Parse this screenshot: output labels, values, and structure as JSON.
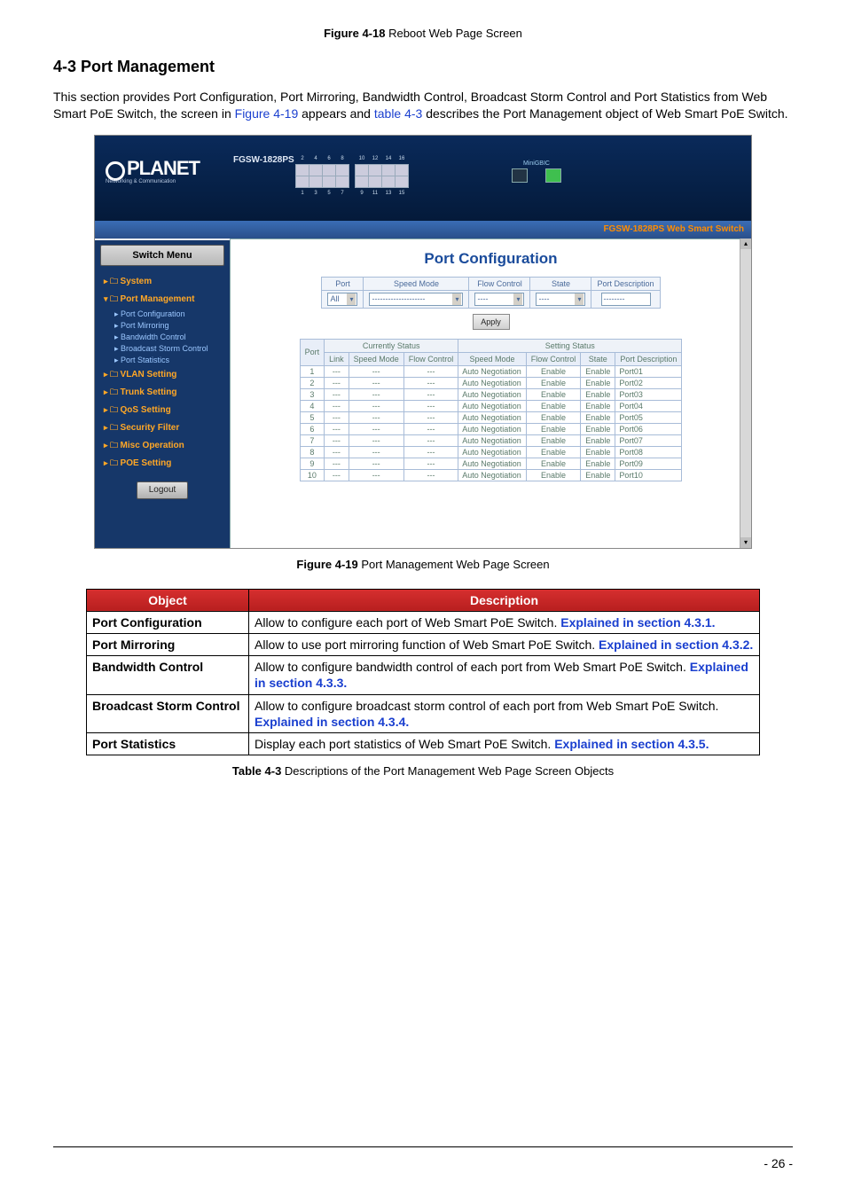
{
  "captions": {
    "fig418_b": "Figure 4-18",
    "fig418_t": " Reboot Web Page Screen",
    "fig419_b": "Figure 4-19",
    "fig419_t": " Port Management Web Page Screen",
    "tbl43_b": "Table 4-3",
    "tbl43_t": " Descriptions of the Port Management Web Page Screen Objects"
  },
  "section": {
    "heading": "4-3 Port Management"
  },
  "intro": {
    "t1": "This section provides Port Configuration, Port Mirroring, Bandwidth Control, Broadcast Storm Control and Port Statistics from Web Smart PoE Switch, the screen in ",
    "l1": "Figure 4-19",
    "t2": " appears and ",
    "l2": "table 4-3",
    "t3": " describes the Port Management object of Web Smart PoE Switch."
  },
  "screenshot": {
    "model": "FGSW-1828PS",
    "logo": "PLANET",
    "logo_sub": "Networking & Communication",
    "mini_label": "MiniGBIC",
    "bar_text": "FGSW-1828PS Web Smart Switch",
    "menu_header": "Switch Menu",
    "menu": [
      {
        "type": "folder",
        "label": "System"
      },
      {
        "type": "folder",
        "label": "Port Management",
        "open": true
      },
      {
        "type": "sub",
        "label": "Port Configuration"
      },
      {
        "type": "sub",
        "label": "Port Mirroring"
      },
      {
        "type": "sub",
        "label": "Bandwidth Control"
      },
      {
        "type": "sub",
        "label": "Broadcast Storm Control"
      },
      {
        "type": "sub",
        "label": "Port Statistics"
      },
      {
        "type": "folder",
        "label": "VLAN Setting"
      },
      {
        "type": "folder",
        "label": "Trunk Setting"
      },
      {
        "type": "folder",
        "label": "QoS Setting"
      },
      {
        "type": "folder",
        "label": "Security Filter"
      },
      {
        "type": "folder",
        "label": "Misc Operation"
      },
      {
        "type": "folder",
        "label": "POE Setting"
      }
    ],
    "logout": "Logout",
    "content_title": "Port Configuration",
    "cfg_headers": [
      "Port",
      "Speed Mode",
      "Flow Control",
      "State",
      "Port Description"
    ],
    "cfg_values": {
      "port": "All",
      "speed": "--------------------",
      "flow": "----",
      "state": "----",
      "desc": "--------"
    },
    "apply": "Apply",
    "status_groups": [
      "Currently Status",
      "Setting Status"
    ],
    "status_headers": [
      "Port",
      "Link",
      "Speed Mode",
      "Flow Control",
      "Speed Mode",
      "Flow Control",
      "State",
      "Port Description"
    ],
    "rows": [
      {
        "p": "1",
        "l": "---",
        "sm": "---",
        "fc": "---",
        "sm2": "Auto Negotiation",
        "fc2": "Enable",
        "st": "Enable",
        "d": "Port01"
      },
      {
        "p": "2",
        "l": "---",
        "sm": "---",
        "fc": "---",
        "sm2": "Auto Negotiation",
        "fc2": "Enable",
        "st": "Enable",
        "d": "Port02"
      },
      {
        "p": "3",
        "l": "---",
        "sm": "---",
        "fc": "---",
        "sm2": "Auto Negotiation",
        "fc2": "Enable",
        "st": "Enable",
        "d": "Port03"
      },
      {
        "p": "4",
        "l": "---",
        "sm": "---",
        "fc": "---",
        "sm2": "Auto Negotiation",
        "fc2": "Enable",
        "st": "Enable",
        "d": "Port04"
      },
      {
        "p": "5",
        "l": "---",
        "sm": "---",
        "fc": "---",
        "sm2": "Auto Negotiation",
        "fc2": "Enable",
        "st": "Enable",
        "d": "Port05"
      },
      {
        "p": "6",
        "l": "---",
        "sm": "---",
        "fc": "---",
        "sm2": "Auto Negotiation",
        "fc2": "Enable",
        "st": "Enable",
        "d": "Port06"
      },
      {
        "p": "7",
        "l": "---",
        "sm": "---",
        "fc": "---",
        "sm2": "Auto Negotiation",
        "fc2": "Enable",
        "st": "Enable",
        "d": "Port07"
      },
      {
        "p": "8",
        "l": "---",
        "sm": "---",
        "fc": "---",
        "sm2": "Auto Negotiation",
        "fc2": "Enable",
        "st": "Enable",
        "d": "Port08"
      },
      {
        "p": "9",
        "l": "---",
        "sm": "---",
        "fc": "---",
        "sm2": "Auto Negotiation",
        "fc2": "Enable",
        "st": "Enable",
        "d": "Port09"
      },
      {
        "p": "10",
        "l": "---",
        "sm": "---",
        "fc": "---",
        "sm2": "Auto Negotiation",
        "fc2": "Enable",
        "st": "Enable",
        "d": "Port10"
      }
    ],
    "port_nums_top": [
      "2",
      "4",
      "6",
      "8",
      "",
      "10",
      "12",
      "14",
      "16"
    ],
    "port_nums_bot": [
      "1",
      "3",
      "5",
      "7",
      "",
      "9",
      "11",
      "13",
      "15"
    ]
  },
  "desc_table": {
    "h_obj": "Object",
    "h_desc": "Description",
    "rows": [
      {
        "obj": "Port Configuration",
        "desc": "Allow to configure each port of Web Smart PoE Switch. ",
        "link": "Explained in section 4.3.1."
      },
      {
        "obj": "Port Mirroring",
        "desc": "Allow to use port mirroring function of Web Smart PoE Switch. ",
        "link": "Explained in section 4.3.2."
      },
      {
        "obj": "Bandwidth Control",
        "desc": "Allow to configure bandwidth control of each port from Web Smart PoE Switch. ",
        "link": "Explained in section 4.3.3."
      },
      {
        "obj": "Broadcast Storm Control",
        "desc": "Allow to configure broadcast storm control of each port from Web Smart PoE Switch. ",
        "link": "Explained in section 4.3.4.",
        "link_prefix": "Ex",
        "link_suffix": "plained in section 4.3.4."
      },
      {
        "obj": "Port Statistics",
        "desc": "Display each port statistics of Web Smart PoE Switch. ",
        "link": "Explained in section 4.3.5."
      }
    ]
  },
  "page_num": "- 26 -"
}
